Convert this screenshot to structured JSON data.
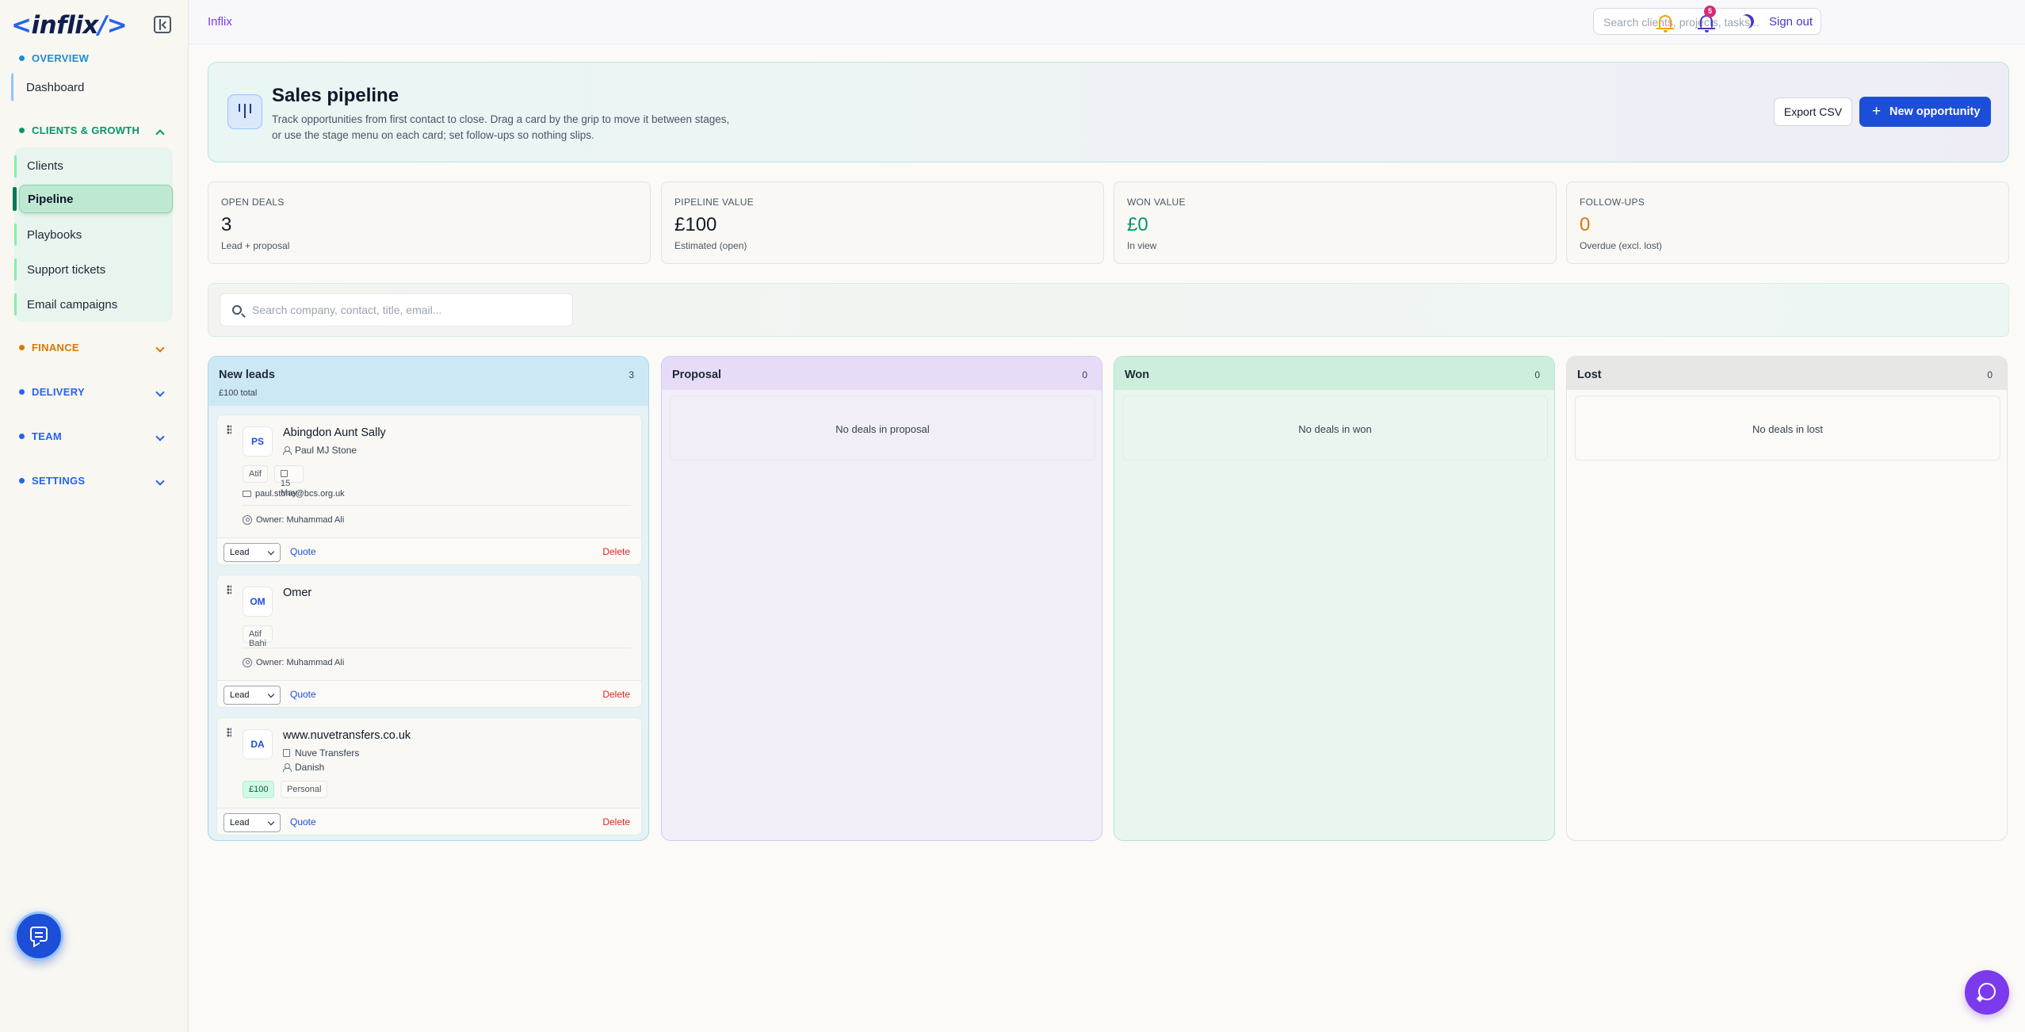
{
  "app": {
    "logo_text": "inflix",
    "logo_open": "<",
    "logo_close": "/>",
    "breadcrumb": "Inflix"
  },
  "sidebar": {
    "sections": {
      "overview": "OVERVIEW",
      "clients_growth": "CLIENTS & GROWTH",
      "finance": "FINANCE",
      "delivery": "DELIVERY",
      "team": "TEAM",
      "settings": "SETTINGS"
    },
    "items": {
      "dashboard": "Dashboard",
      "clients": "Clients",
      "pipeline": "Pipeline",
      "playbooks": "Playbooks",
      "support_tickets": "Support tickets",
      "email_campaigns": "Email campaigns"
    },
    "colors": {
      "overview": "#1d8ecf",
      "clients_growth": "#059669",
      "finance": "#d97706",
      "delivery": "#2563eb",
      "team": "#2563eb",
      "settings": "#2563eb"
    }
  },
  "topbar": {
    "search_placeholder": "Search clients, projects, tasks...",
    "notification_count": "5",
    "sign_out": "Sign out"
  },
  "hero": {
    "title": "Sales pipeline",
    "description": "Track opportunities from first contact to close. Drag a card by the grip to move it between stages, or use the stage menu on each card; set follow-ups so nothing slips.",
    "export_label": "Export CSV",
    "new_label": "New opportunity"
  },
  "stats": [
    {
      "label": "OPEN DEALS",
      "value": "3",
      "sub": "Lead + proposal",
      "color": "#111827"
    },
    {
      "label": "PIPELINE VALUE",
      "value": "£100",
      "sub": "Estimated (open)",
      "color": "#111827"
    },
    {
      "label": "WON VALUE",
      "value": "£0",
      "sub": "In view",
      "color": "#059669"
    },
    {
      "label": "FOLLOW-UPS",
      "value": "0",
      "sub": "Overdue (excl. lost)",
      "color": "#d97706"
    }
  ],
  "filter": {
    "placeholder": "Search company, contact, title, email..."
  },
  "columns": [
    {
      "title": "New leads",
      "count": "3",
      "total": "£100 total",
      "color": "#cde8f5"
    },
    {
      "title": "Proposal",
      "count": "0",
      "empty": "No deals in proposal",
      "color": "#e6dcf7"
    },
    {
      "title": "Won",
      "count": "0",
      "empty": "No deals in won",
      "color": "#cdeedd"
    },
    {
      "title": "Lost",
      "count": "0",
      "empty": "No deals in lost",
      "color": "#e7e7e6"
    }
  ],
  "cards": [
    {
      "initials": "PS",
      "name": "Abingdon Aunt Sally",
      "contact": "Paul MJ Stone",
      "tag1": "Atif",
      "date": "15 May",
      "email": "paul.stone@bcs.org.uk",
      "owner": "Owner: Muhammad Ali",
      "stage": "Lead",
      "quote": "Quote",
      "delete": "Delete"
    },
    {
      "initials": "OM",
      "name": "Omer",
      "tag1": "Atif Bahi",
      "owner": "Owner: Muhammad Ali",
      "stage": "Lead",
      "quote": "Quote",
      "delete": "Delete"
    },
    {
      "initials": "DA",
      "name": "www.nuvetransfers.co.uk",
      "company": "Nuve Transfers",
      "contact": "Danish",
      "value": "£100",
      "tag1": "Personal",
      "stage": "Lead",
      "quote": "Quote",
      "delete": "Delete"
    }
  ]
}
